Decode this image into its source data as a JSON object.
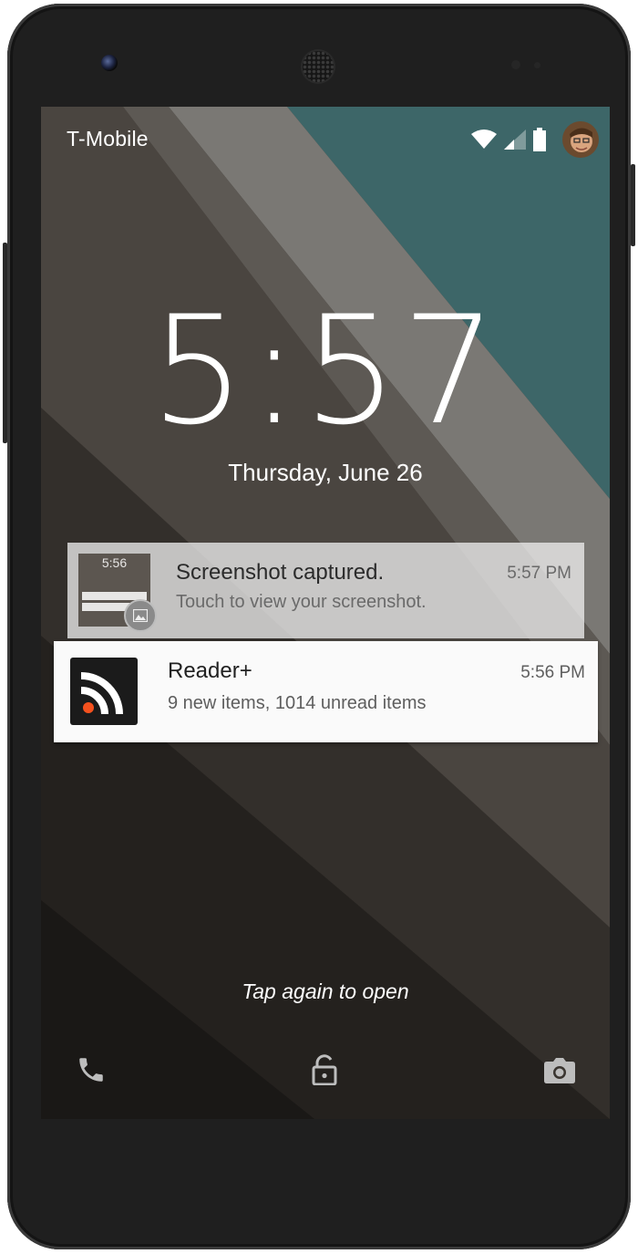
{
  "status_bar": {
    "carrier": "T-Mobile",
    "icons": [
      "wifi-icon",
      "cell-signal-icon",
      "battery-icon",
      "user-avatar"
    ]
  },
  "lockscreen": {
    "time": "5:57",
    "date": "Thursday, June 26",
    "hint": "Tap again to open"
  },
  "notifications": [
    {
      "title": "Screenshot captured.",
      "text": "Touch to view your screenshot.",
      "time": "5:57 PM",
      "thumbnail_time": "5:56",
      "icon": "image-icon"
    },
    {
      "title": "Reader+",
      "text": "9 new items, 1014 unread items",
      "time": "5:56 PM",
      "icon": "rss-icon"
    }
  ],
  "bottom_actions": [
    "phone-icon",
    "unlock-icon",
    "camera-icon"
  ],
  "colors": {
    "teal": "#3d6668",
    "rss_orange": "#f4511e",
    "phone_body": "#1f1f1f"
  }
}
